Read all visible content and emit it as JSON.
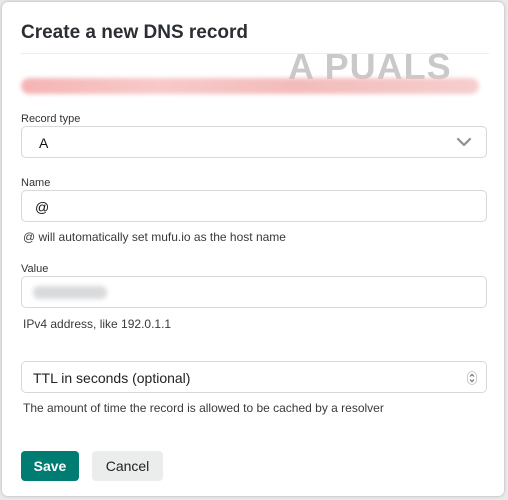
{
  "dialog": {
    "title": "Create a new DNS record"
  },
  "watermark": {
    "text": "A  PUALS"
  },
  "form": {
    "record_type": {
      "label": "Record type",
      "value": "A",
      "icon": "chevron-down-icon"
    },
    "name": {
      "label": "Name",
      "value": "@",
      "help": "@ will automatically set mufu.io as the host name"
    },
    "value": {
      "label": "Value",
      "help": "IPv4 address, like 192.0.1.1"
    },
    "ttl": {
      "placeholder": "TTL in seconds (optional)",
      "help": "The amount of time the record is allowed to be cached by a resolver",
      "icon": "stepper-icon"
    }
  },
  "buttons": {
    "save": "Save",
    "cancel": "Cancel"
  },
  "colors": {
    "primary": "#017c72",
    "secondary_button": "#ebeded",
    "border": "#d6d8da"
  }
}
